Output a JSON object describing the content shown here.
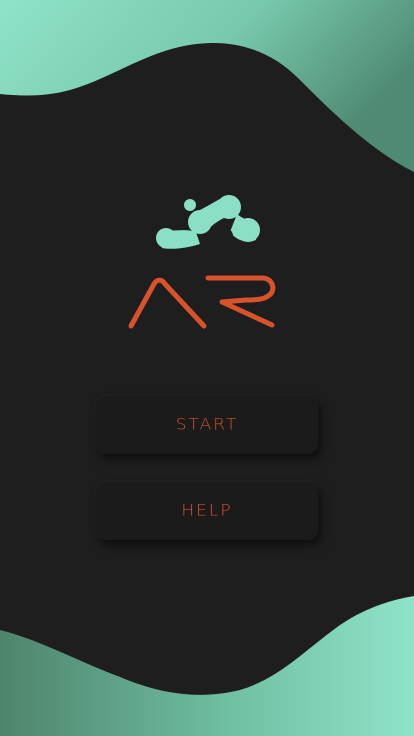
{
  "menu": {
    "start_label": "START",
    "help_label": "HELP"
  },
  "logo": {
    "text": "AR",
    "icon": "molecule-blob-icon"
  },
  "colors": {
    "background": "#1e1e1e",
    "wave_light": "#8adfc4",
    "wave_dark": "#5a8f79",
    "accent": "#d8532c",
    "button_bg": "#1b1b1b"
  }
}
